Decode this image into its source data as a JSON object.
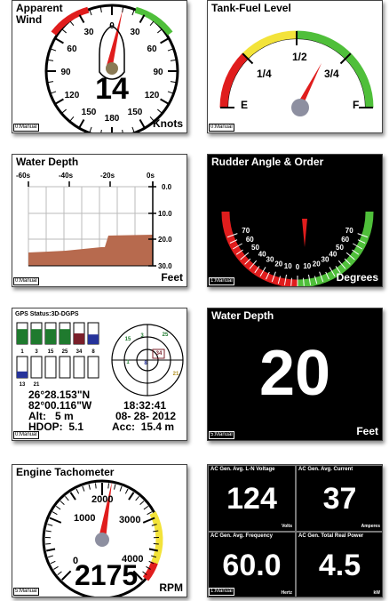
{
  "wind": {
    "title_line1": "Apparent",
    "title_line2": "Wind",
    "value": "14",
    "unit": "Knots",
    "mode": "0:Manual",
    "labels": [
      "0",
      "30",
      "60",
      "90",
      "120",
      "150",
      "180",
      "150",
      "120",
      "90",
      "60",
      "30"
    ]
  },
  "tank": {
    "title": "Tank-Fuel Level",
    "labels": [
      "E",
      "1/4",
      "1/2",
      "3/4",
      "F"
    ],
    "level": 0.7,
    "mode": "0:Manual"
  },
  "depth_chart": {
    "title": "Water Depth",
    "unit": "Feet",
    "mode": "0:Manual",
    "x_ticks": [
      "-60s",
      "-40s",
      "-20s",
      "0s"
    ],
    "y_ticks": [
      "0.0",
      "10.0",
      "20.0",
      "30.0"
    ]
  },
  "rudder": {
    "title": "Rudder Angle & Order",
    "unit": "Degrees",
    "mode": "1:Manual",
    "labels": [
      "70",
      "60",
      "50",
      "40",
      "30",
      "20",
      "10",
      "0",
      "10",
      "20",
      "30",
      "40",
      "50",
      "60",
      "70"
    ]
  },
  "gps": {
    "status": "GPS Status:3D-DGPS",
    "lat": "26°28.153\"N",
    "lon": "82°00.116\"W",
    "alt_label": "Alt:",
    "alt_value": "5 m",
    "hdop_label": "HDOP:",
    "hdop_value": "5.1",
    "time": "18:32:41",
    "date": "08- 28- 2012",
    "acc_label": "Acc:",
    "acc_value": "15.4 m",
    "mode": "0:Manual",
    "sat_ids_row1": [
      "1",
      "3",
      "15",
      "25",
      "34",
      "8"
    ],
    "sat_ids_row2": [
      "13",
      "21",
      "",
      "",
      "",
      ""
    ],
    "sky_sats": [
      "15",
      "3",
      "25",
      "1",
      "8",
      "34",
      "21"
    ]
  },
  "water_depth": {
    "title": "Water Depth",
    "value": "20",
    "unit": "Feet",
    "mode": "5:Manual"
  },
  "tach": {
    "title": "Engine Tachometer",
    "value": "2175",
    "unit": "RPM",
    "mode": "5:Manual",
    "labels": [
      "0",
      "1000",
      "2000",
      "3000",
      "4000"
    ]
  },
  "ac": {
    "mode": "1:Manual",
    "cells": [
      {
        "title": "AC Gen. Avg. L-N Voltage",
        "value": "124",
        "unit": "Volts"
      },
      {
        "title": "AC Gen. Avg. Current",
        "value": "37",
        "unit": "Amperes"
      },
      {
        "title": "AC Gen. Avg. Frequency",
        "value": "60.0",
        "unit": "Hertz"
      },
      {
        "title": "AC Gen. Total Real Power",
        "value": "4.5",
        "unit": "kW"
      }
    ]
  },
  "colors": {
    "red": "#e01d1d",
    "green": "#4fbf3a",
    "yellow": "#f3e33a",
    "depth_fill": "#b76a4e",
    "sat_green": "#1f7a2e",
    "sat_maroon": "#7a1f2a",
    "sat_blue": "#26339a"
  }
}
